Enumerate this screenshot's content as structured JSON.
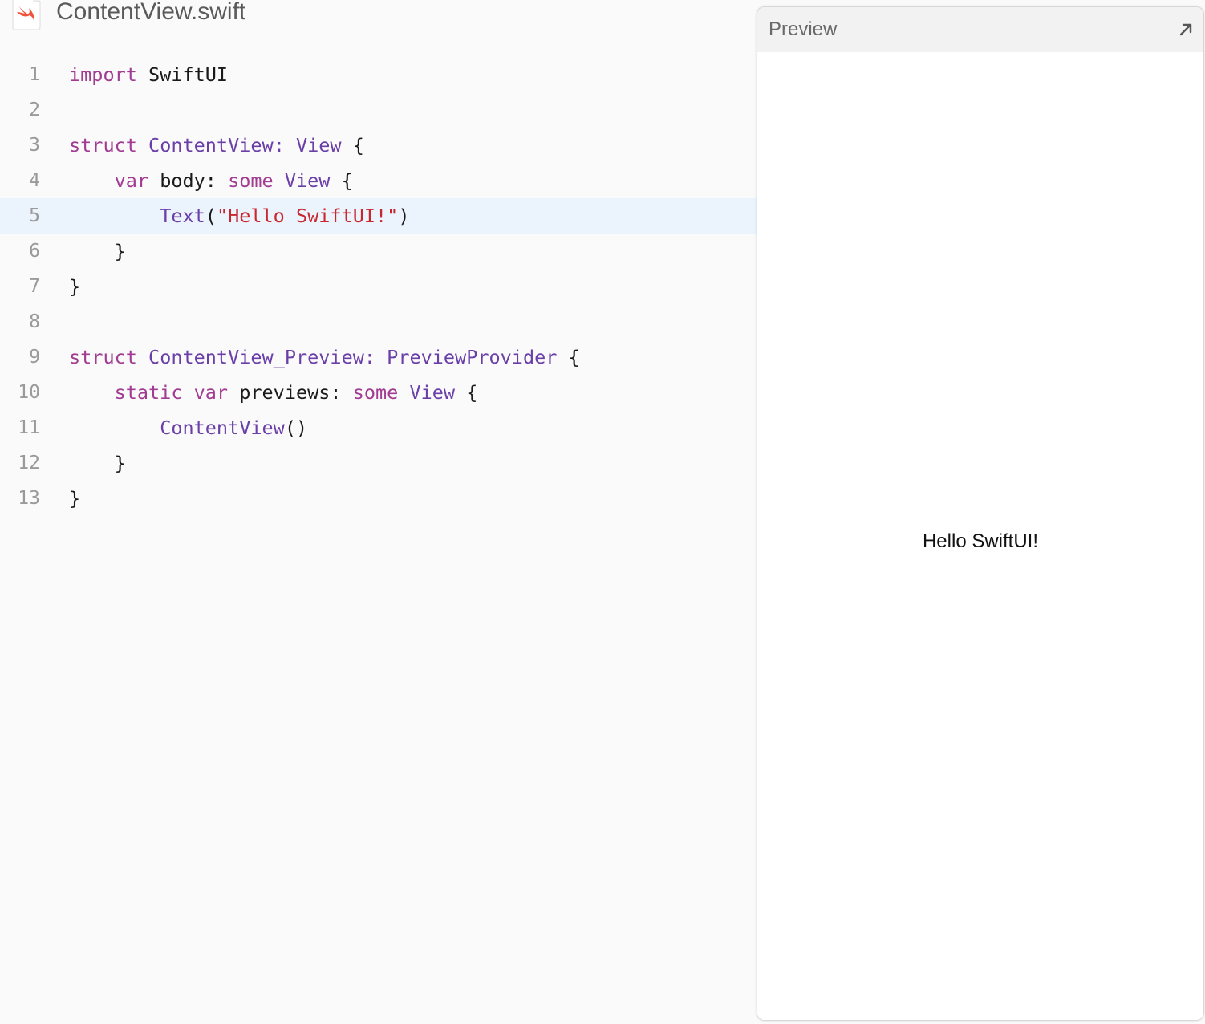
{
  "file": {
    "name": "ContentView.swift",
    "icon": "swift-file-icon"
  },
  "editor": {
    "highlighted_line": 5,
    "lines": [
      {
        "number": "1",
        "tokens": [
          {
            "t": "import",
            "k": "keyword"
          },
          {
            "t": " SwiftUI",
            "k": "plain"
          }
        ]
      },
      {
        "number": "2",
        "tokens": []
      },
      {
        "number": "3",
        "tokens": [
          {
            "t": "struct",
            "k": "keyword"
          },
          {
            "t": " ",
            "k": "plain"
          },
          {
            "t": "ContentView",
            "k": "type"
          },
          {
            "t": ": ",
            "k": "type"
          },
          {
            "t": "View",
            "k": "type"
          },
          {
            "t": " {",
            "k": "plain"
          }
        ]
      },
      {
        "number": "4",
        "tokens": [
          {
            "t": "    ",
            "k": "plain"
          },
          {
            "t": "var",
            "k": "keyword"
          },
          {
            "t": " body: ",
            "k": "plain"
          },
          {
            "t": "some",
            "k": "keyword"
          },
          {
            "t": " ",
            "k": "plain"
          },
          {
            "t": "View",
            "k": "type"
          },
          {
            "t": " {",
            "k": "plain"
          }
        ]
      },
      {
        "number": "5",
        "tokens": [
          {
            "t": "        ",
            "k": "plain"
          },
          {
            "t": "Text",
            "k": "type"
          },
          {
            "t": "(",
            "k": "plain"
          },
          {
            "t": "\"Hello SwiftUI!\"",
            "k": "string"
          },
          {
            "t": ")",
            "k": "plain"
          }
        ]
      },
      {
        "number": "6",
        "tokens": [
          {
            "t": "    }",
            "k": "plain"
          }
        ]
      },
      {
        "number": "7",
        "tokens": [
          {
            "t": "}",
            "k": "plain"
          }
        ]
      },
      {
        "number": "8",
        "tokens": []
      },
      {
        "number": "9",
        "tokens": [
          {
            "t": "struct",
            "k": "keyword"
          },
          {
            "t": " ",
            "k": "plain"
          },
          {
            "t": "ContentView_Preview",
            "k": "type"
          },
          {
            "t": ": ",
            "k": "type"
          },
          {
            "t": "PreviewProvider",
            "k": "type"
          },
          {
            "t": " {",
            "k": "plain"
          }
        ]
      },
      {
        "number": "10",
        "tokens": [
          {
            "t": "    ",
            "k": "plain"
          },
          {
            "t": "static",
            "k": "keyword"
          },
          {
            "t": " ",
            "k": "plain"
          },
          {
            "t": "var",
            "k": "keyword"
          },
          {
            "t": " previews: ",
            "k": "plain"
          },
          {
            "t": "some",
            "k": "keyword"
          },
          {
            "t": " ",
            "k": "plain"
          },
          {
            "t": "View",
            "k": "type"
          },
          {
            "t": " {",
            "k": "plain"
          }
        ]
      },
      {
        "number": "11",
        "tokens": [
          {
            "t": "        ",
            "k": "plain"
          },
          {
            "t": "ContentView",
            "k": "type"
          },
          {
            "t": "()",
            "k": "plain"
          }
        ]
      },
      {
        "number": "12",
        "tokens": [
          {
            "t": "    }",
            "k": "plain"
          }
        ]
      },
      {
        "number": "13",
        "tokens": [
          {
            "t": "}",
            "k": "plain"
          }
        ]
      }
    ]
  },
  "preview": {
    "title": "Preview",
    "expand_icon": "expand-arrow-icon",
    "rendered_text": "Hello SwiftUI!"
  },
  "colors": {
    "keyword": "#a13c92",
    "type": "#6a3fa8",
    "string": "#c8282d",
    "highlight": "#ebf3fd"
  }
}
